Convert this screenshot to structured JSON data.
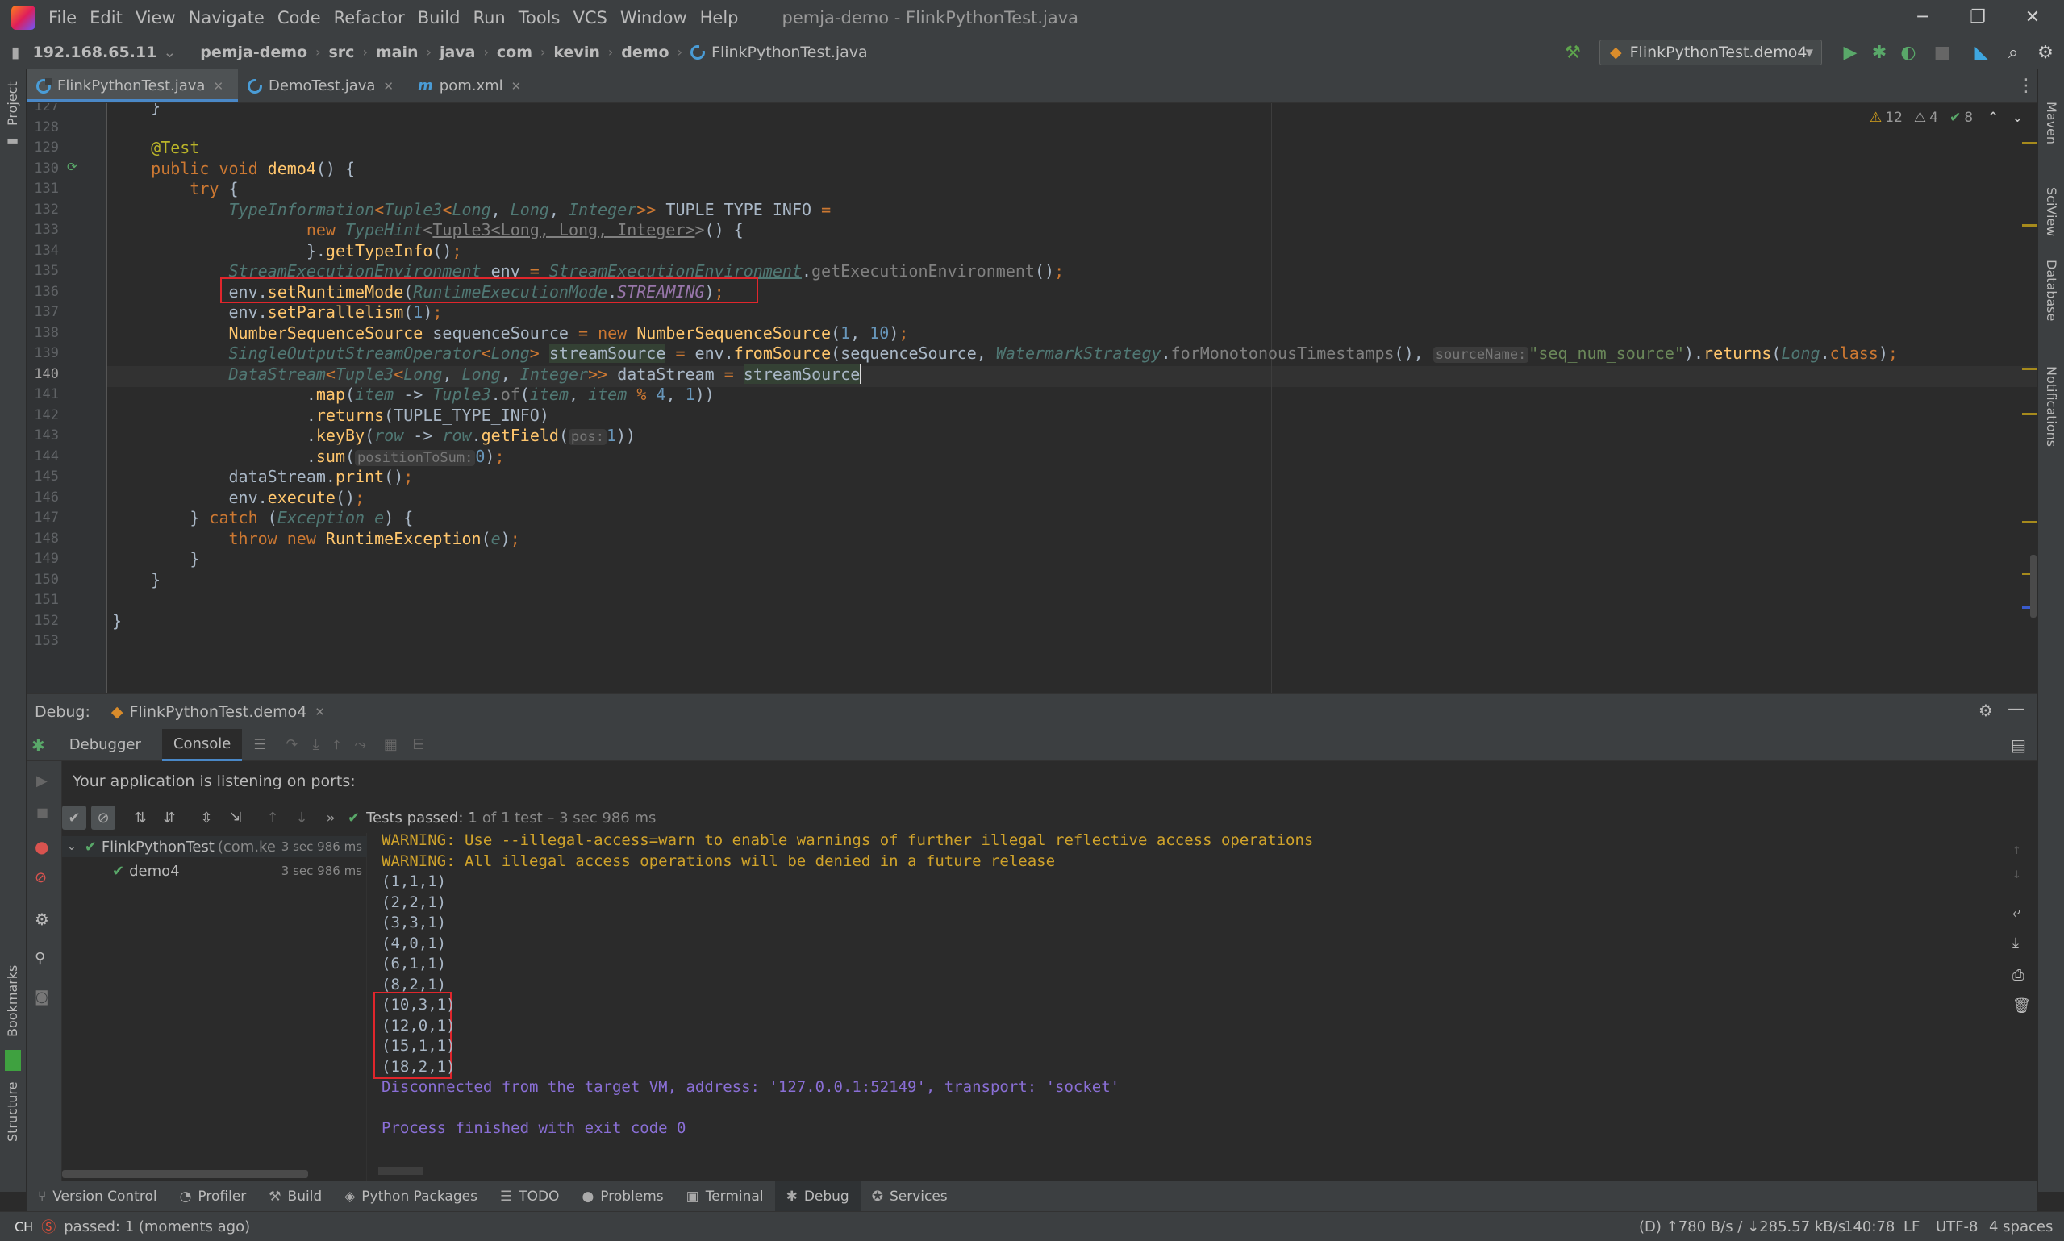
{
  "menubar": {
    "items": [
      "File",
      "Edit",
      "View",
      "Navigate",
      "Code",
      "Refactor",
      "Build",
      "Run",
      "Tools",
      "VCS",
      "Window",
      "Help"
    ],
    "window_title": "pemja-demo - FlinkPythonTest.java",
    "minimize": "─",
    "restore": "❐",
    "close": "✕"
  },
  "navbar": {
    "host": "192.168.65.11",
    "crumbs": [
      "pemja-demo",
      "src",
      "main",
      "java",
      "com",
      "kevin",
      "demo"
    ],
    "file": "FlinkPythonTest.java",
    "run_config": "FlinkPythonTest.demo4"
  },
  "editor_tabs": [
    {
      "label": "FlinkPythonTest.java"
    },
    {
      "label": "DemoTest.java"
    },
    {
      "label": "pom.xml"
    }
  ],
  "inspections": {
    "warnings_a": "12",
    "warnings_b": "4",
    "ok": "8"
  },
  "side_left": {
    "project": "Project",
    "bookmarks": "Bookmarks",
    "structure": "Structure"
  },
  "side_right": {
    "maven": "Maven",
    "sciview": "SciView",
    "database": "Database",
    "notifications": "Notifications"
  },
  "line_numbers": [
    "127",
    "128",
    "129",
    "130",
    "131",
    "132",
    "133",
    "134",
    "135",
    "136",
    "137",
    "138",
    "139",
    "140",
    "141",
    "142",
    "143",
    "144",
    "145",
    "146",
    "147",
    "148",
    "149",
    "150",
    "151",
    "152",
    "153"
  ],
  "code_hints": {
    "source_name": "sourceName:",
    "pos": "pos:",
    "position_to_sum": "positionToSum:"
  },
  "debug": {
    "label": "Debug:",
    "session": "FlinkPythonTest.demo4",
    "tab_debugger": "Debugger",
    "tab_console": "Console",
    "listening": "Your application is listening on ports:",
    "tests_passed": "Tests passed:",
    "tests_count": "1",
    "tests_detail": "of 1 test – 3 sec 986 ms"
  },
  "tree": [
    {
      "name": "FlinkPythonTest",
      "pkg": "(com.ke",
      "time": "3 sec 986 ms"
    },
    {
      "name": "demo4",
      "time": "3 sec 986 ms"
    }
  ],
  "console": {
    "lines": [
      {
        "t": "WARNING: Use --illegal-access=warn to enable warnings of further illegal reflective access operations",
        "k": "warn"
      },
      {
        "t": "WARNING: All illegal access operations will be denied in a future release",
        "k": "warn"
      },
      {
        "t": "(1,1,1)",
        "k": "out"
      },
      {
        "t": "(2,2,1)",
        "k": "out"
      },
      {
        "t": "(3,3,1)",
        "k": "out"
      },
      {
        "t": "(4,0,1)",
        "k": "out"
      },
      {
        "t": "(6,1,1)",
        "k": "out"
      },
      {
        "t": "(8,2,1)",
        "k": "out"
      },
      {
        "t": "(10,3,1)",
        "k": "out"
      },
      {
        "t": "(12,0,1)",
        "k": "out"
      },
      {
        "t": "(15,1,1)",
        "k": "out"
      },
      {
        "t": "(18,2,1)",
        "k": "out"
      },
      {
        "t": "Disconnected from the target VM, address: '127.0.0.1:52149', transport: 'socket'",
        "k": "info"
      },
      {
        "t": "",
        "k": "out"
      },
      {
        "t": "Process finished with exit code 0",
        "k": "info"
      }
    ]
  },
  "tool_windows": [
    {
      "label": "Version Control",
      "icon": "⑂"
    },
    {
      "label": "Profiler",
      "icon": "◔"
    },
    {
      "label": "Build",
      "icon": "⚒"
    },
    {
      "label": "Python Packages",
      "icon": "◈"
    },
    {
      "label": "TODO",
      "icon": "☰"
    },
    {
      "label": "Problems",
      "icon": "●"
    },
    {
      "label": "Terminal",
      "icon": "▣"
    },
    {
      "label": "Debug",
      "icon": "✱"
    },
    {
      "label": "Services",
      "icon": "✪"
    }
  ],
  "status": {
    "message": "passed: 1 (moments ago)",
    "ime": "CH",
    "network": "(D) ↑780 B/s / ↓285.57 kB/s",
    "position": "140:78",
    "line_sep": "LF",
    "encoding": "UTF-8",
    "indent": "4 spaces"
  }
}
